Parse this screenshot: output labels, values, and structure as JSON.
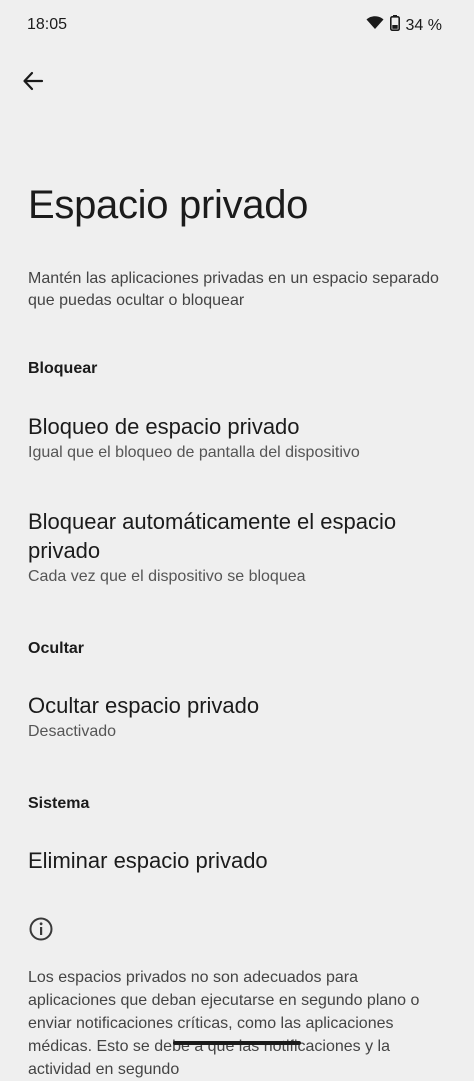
{
  "status_bar": {
    "time": "18:05",
    "battery": "34 %",
    "icons": [
      "wifi-icon",
      "battery-icon"
    ]
  },
  "toolbar": {
    "back_icon": "arrow-back-icon"
  },
  "page": {
    "title": "Espacio privado",
    "description": "Mantén las aplicaciones privadas en un espacio separado que puedas ocultar o bloquear"
  },
  "sections": {
    "lock": {
      "header": "Bloquear",
      "items": [
        {
          "title": "Bloqueo de espacio privado",
          "summary": "Igual que el bloqueo de pantalla del dispositivo"
        },
        {
          "title": "Bloquear automáticamente el espacio privado",
          "summary": "Cada vez que el dispositivo se bloquea"
        }
      ]
    },
    "hide": {
      "header": "Ocultar",
      "items": [
        {
          "title": "Ocultar espacio privado",
          "summary": "Desactivado"
        }
      ]
    },
    "system": {
      "header": "Sistema",
      "items": [
        {
          "title": "Eliminar espacio privado"
        }
      ]
    }
  },
  "footer": {
    "info_icon": "info-icon",
    "text": "Los espacios privados no son adecuados para aplicaciones que deban ejecutarse en segundo plano o enviar notificaciones críticas, como las aplicaciones médicas. Esto se debe a que las notificaciones y la actividad en segundo"
  },
  "colors": {
    "background": "#efefef",
    "text_primary": "#1b1b1b",
    "text_secondary": "#555555"
  }
}
